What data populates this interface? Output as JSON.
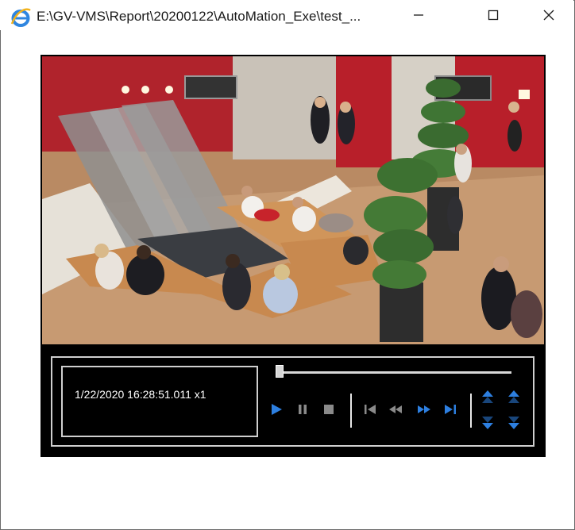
{
  "window": {
    "title": "E:\\GV-VMS\\Report\\20200122\\AutoMation_Exe\\test_...",
    "icon": "internet-explorer-icon",
    "buttons": [
      "minimize-icon",
      "maximize-icon",
      "close-icon"
    ]
  },
  "player": {
    "timestamp": "1/22/2020 16:28:51.011 x1",
    "position_fraction": 0.0,
    "controls": [
      "play-icon",
      "pause-icon",
      "stop-icon",
      "skip-to-start-icon",
      "rewind-icon",
      "fast-forward-icon",
      "skip-to-end-icon",
      "speed-up-icon",
      "frame-up-icon",
      "speed-down-icon",
      "frame-down-icon"
    ],
    "accent_color": "#2d7fe0"
  }
}
